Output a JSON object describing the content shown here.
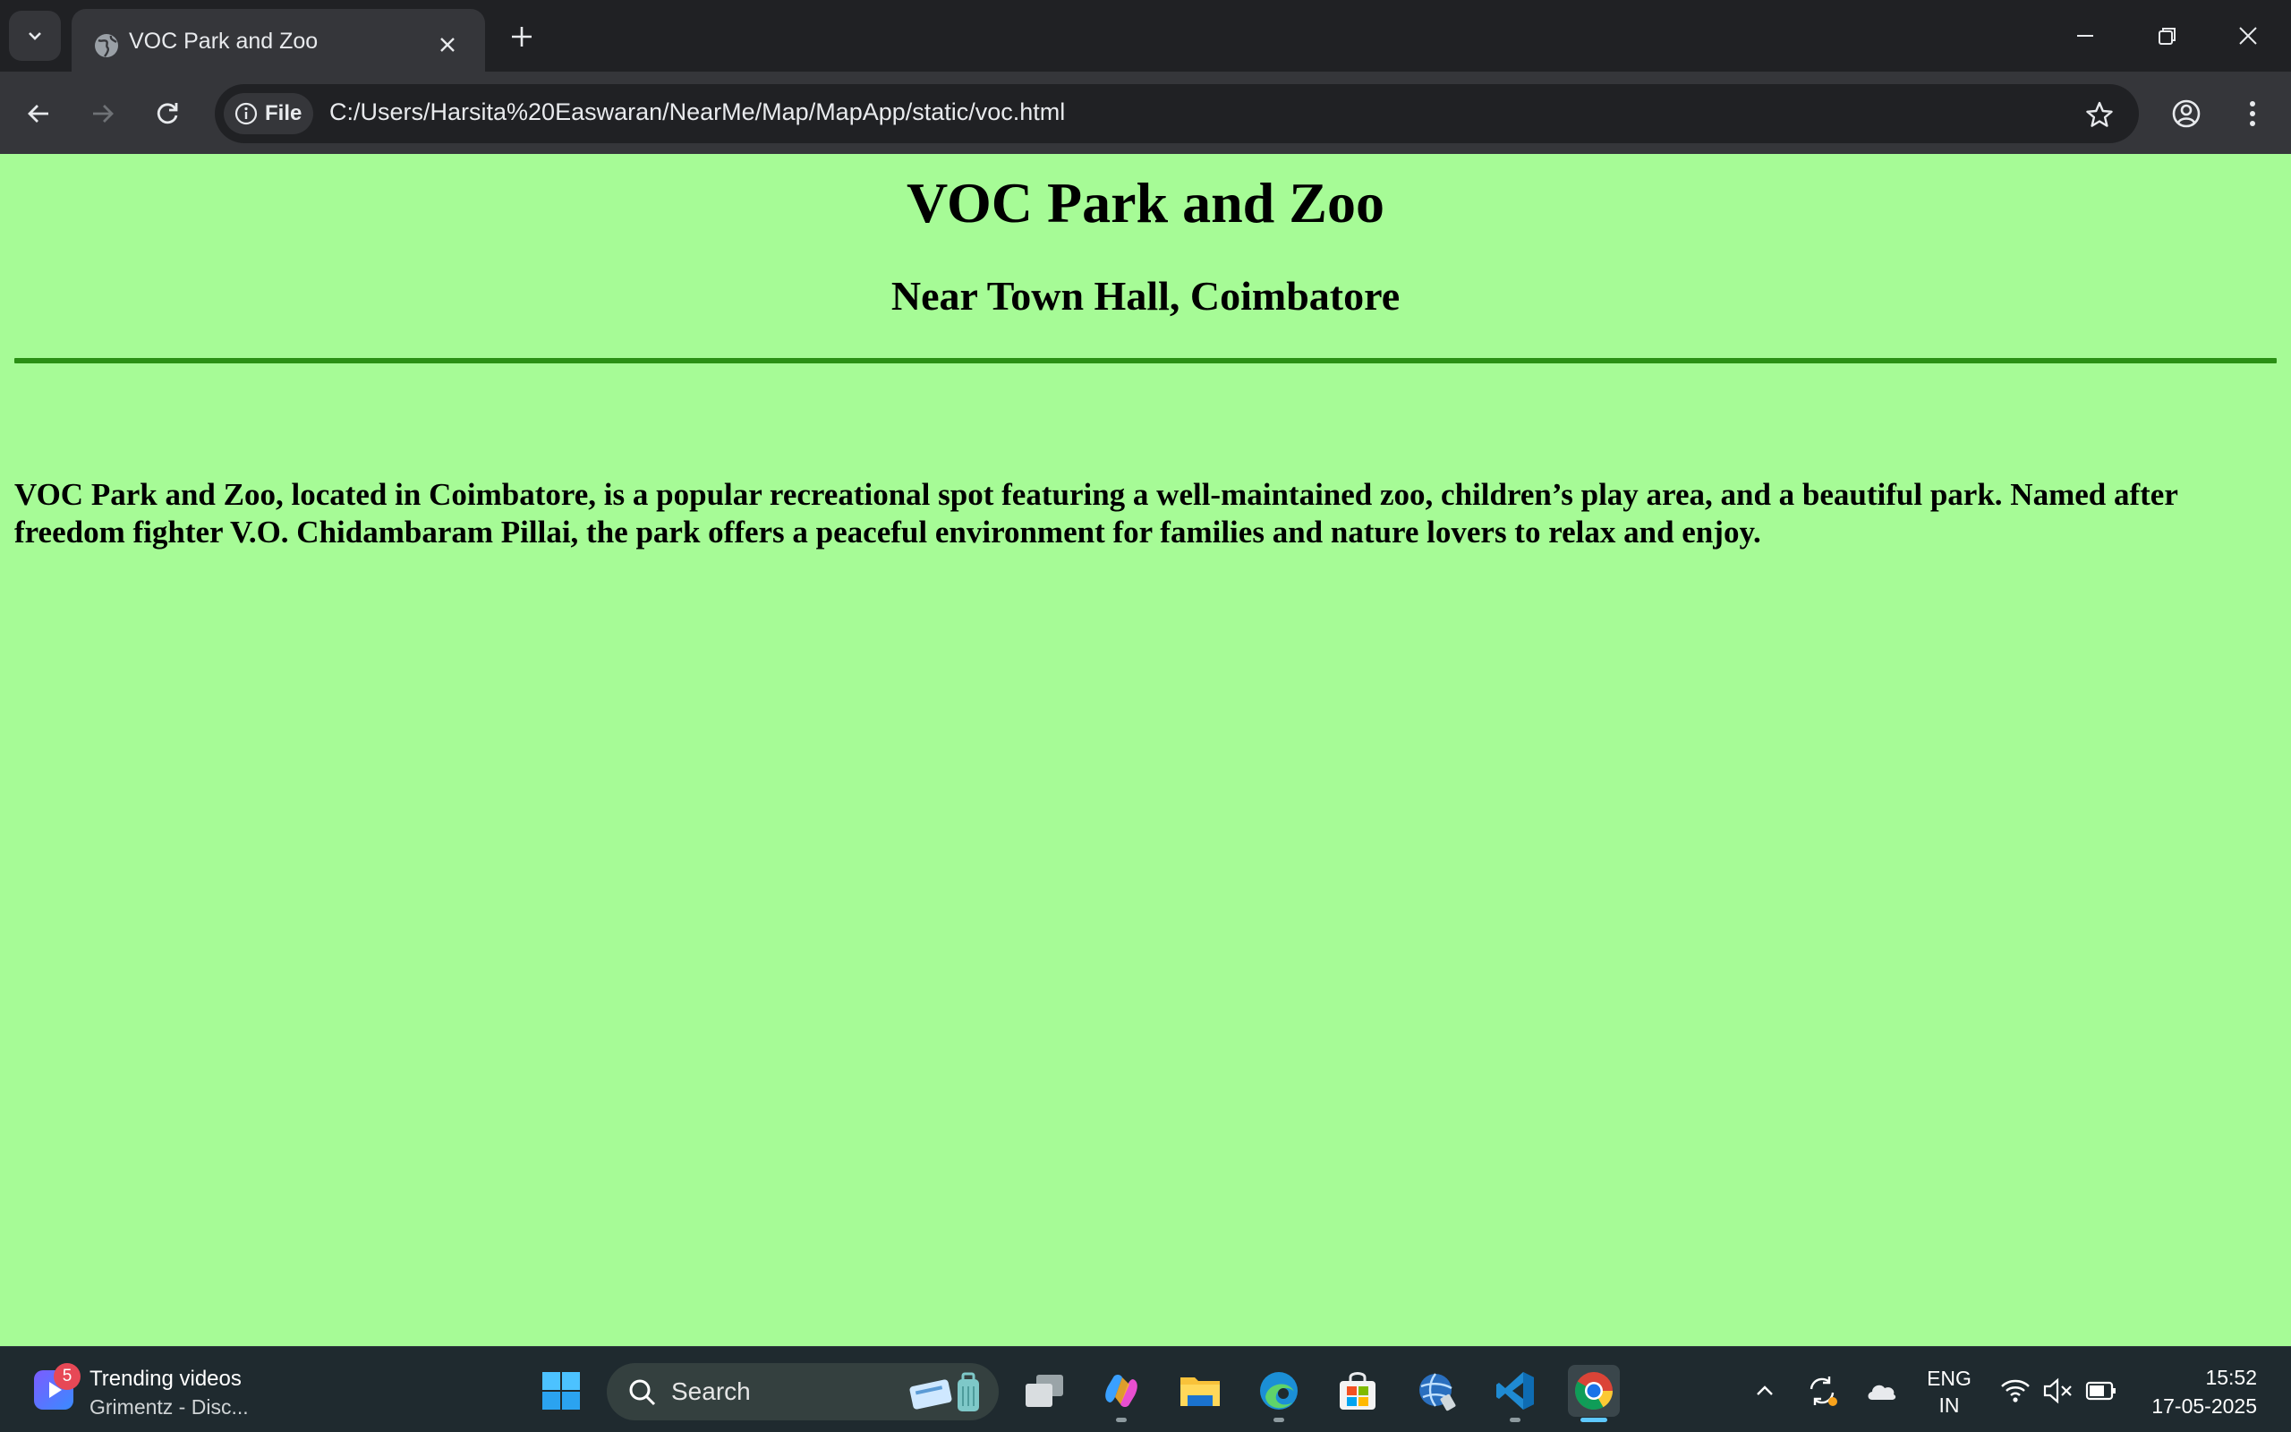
{
  "browser": {
    "tab_title": "VOC Park and Zoo",
    "site_chip_label": "File",
    "url": "C:/Users/Harsita%20Easwaran/NearMe/Map/MapApp/static/voc.html"
  },
  "page": {
    "title": "VOC Park and Zoo",
    "subtitle": "Near Town Hall, Coimbatore",
    "description": "VOC Park and Zoo, located in Coimbatore, is a popular recreational spot featuring a well-maintained zoo, children’s play area, and a beautiful park. Named after freedom fighter V.O. Chidambaram Pillai, the park offers a peaceful environment for families and nature lovers to relax and enjoy.",
    "background_color": "#a6fb96",
    "rule_color": "#2a8f14"
  },
  "taskbar": {
    "widget_badge": "5",
    "widget_title": "Trending videos",
    "widget_subtitle": "Grimentz - Disc...",
    "search_placeholder": "Search",
    "lang_line1": "ENG",
    "lang_line2": "IN",
    "time": "15:52",
    "date": "17-05-2025"
  },
  "icons": [
    "tab-search-icon",
    "globe-icon",
    "close-icon",
    "plus-icon",
    "minimize-icon",
    "restore-icon",
    "window-close-icon",
    "back-icon",
    "forward-icon",
    "reload-icon",
    "info-icon",
    "star-icon",
    "profile-icon",
    "menu-icon",
    "windows-start-icon",
    "search-icon",
    "task-view-icon",
    "copilot-icon",
    "file-explorer-icon",
    "edge-icon",
    "store-icon",
    "globe-app-icon",
    "vscode-icon",
    "chrome-icon",
    "chevron-up-icon",
    "sync-icon",
    "cloud-icon",
    "wifi-icon",
    "volume-muted-icon",
    "battery-icon"
  ]
}
